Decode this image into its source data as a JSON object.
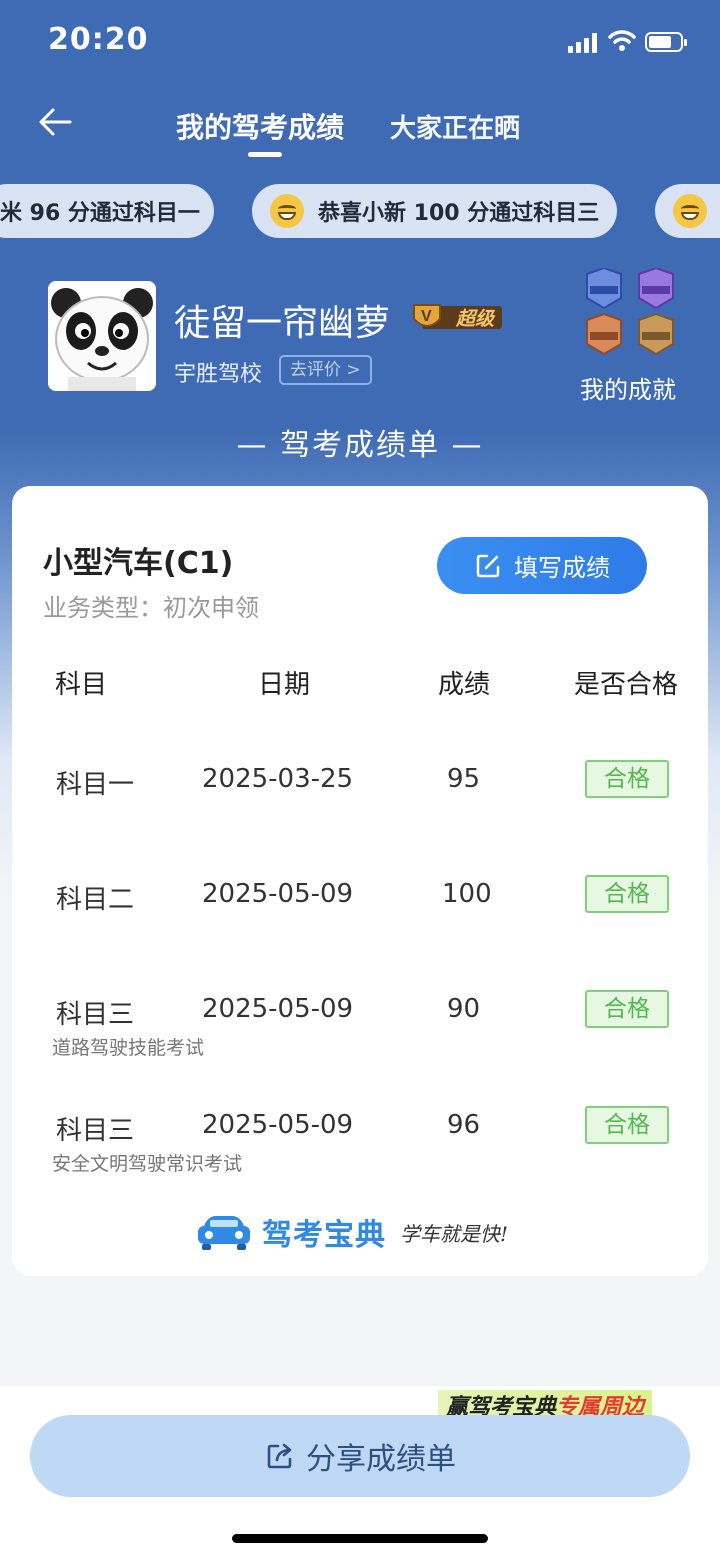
{
  "status_bar": {
    "time": "20:20"
  },
  "nav": {
    "active_tab": "我的驾考成绩",
    "other_tab": "大家正在晒"
  },
  "ticker": [
    {
      "text": "米 96 分通过科目一"
    },
    {
      "text": "恭喜小新 100 分通过科目三"
    }
  ],
  "profile": {
    "username": "徒留一帘幽萝",
    "vip_label": "超级",
    "school": "宇胜驾校",
    "rate_label": "去评价 >",
    "achievement_label": "我的成就"
  },
  "sheet_title": "— 驾考成绩单 —",
  "card": {
    "car_type": "小型汽车(C1)",
    "business_type": "业务类型：初次申领",
    "fill_button": "填写成绩",
    "headers": [
      "科目",
      "日期",
      "成绩",
      "是否合格"
    ],
    "rows": [
      {
        "subject": "科目一",
        "date": "2025-03-25",
        "score": "95",
        "status": "合格",
        "note": ""
      },
      {
        "subject": "科目二",
        "date": "2025-05-09",
        "score": "100",
        "status": "合格",
        "note": ""
      },
      {
        "subject": "科目三",
        "date": "2025-05-09",
        "score": "90",
        "status": "合格",
        "note": "道路驾驶技能考试"
      },
      {
        "subject": "科目三",
        "date": "2025-05-09",
        "score": "96",
        "status": "合格",
        "note": "安全文明驾驶常识考试"
      }
    ],
    "brand_name": "驾考宝典",
    "brand_slogan": "学车就是快!"
  },
  "promo": {
    "prefix": "赢驾考宝典",
    "highlight": "专属周边"
  },
  "share_button": "分享成绩单",
  "colors": {
    "primary_blue": "#3f6bb4",
    "button_blue": "#2f7be8",
    "pass_green": "#56b64f"
  }
}
